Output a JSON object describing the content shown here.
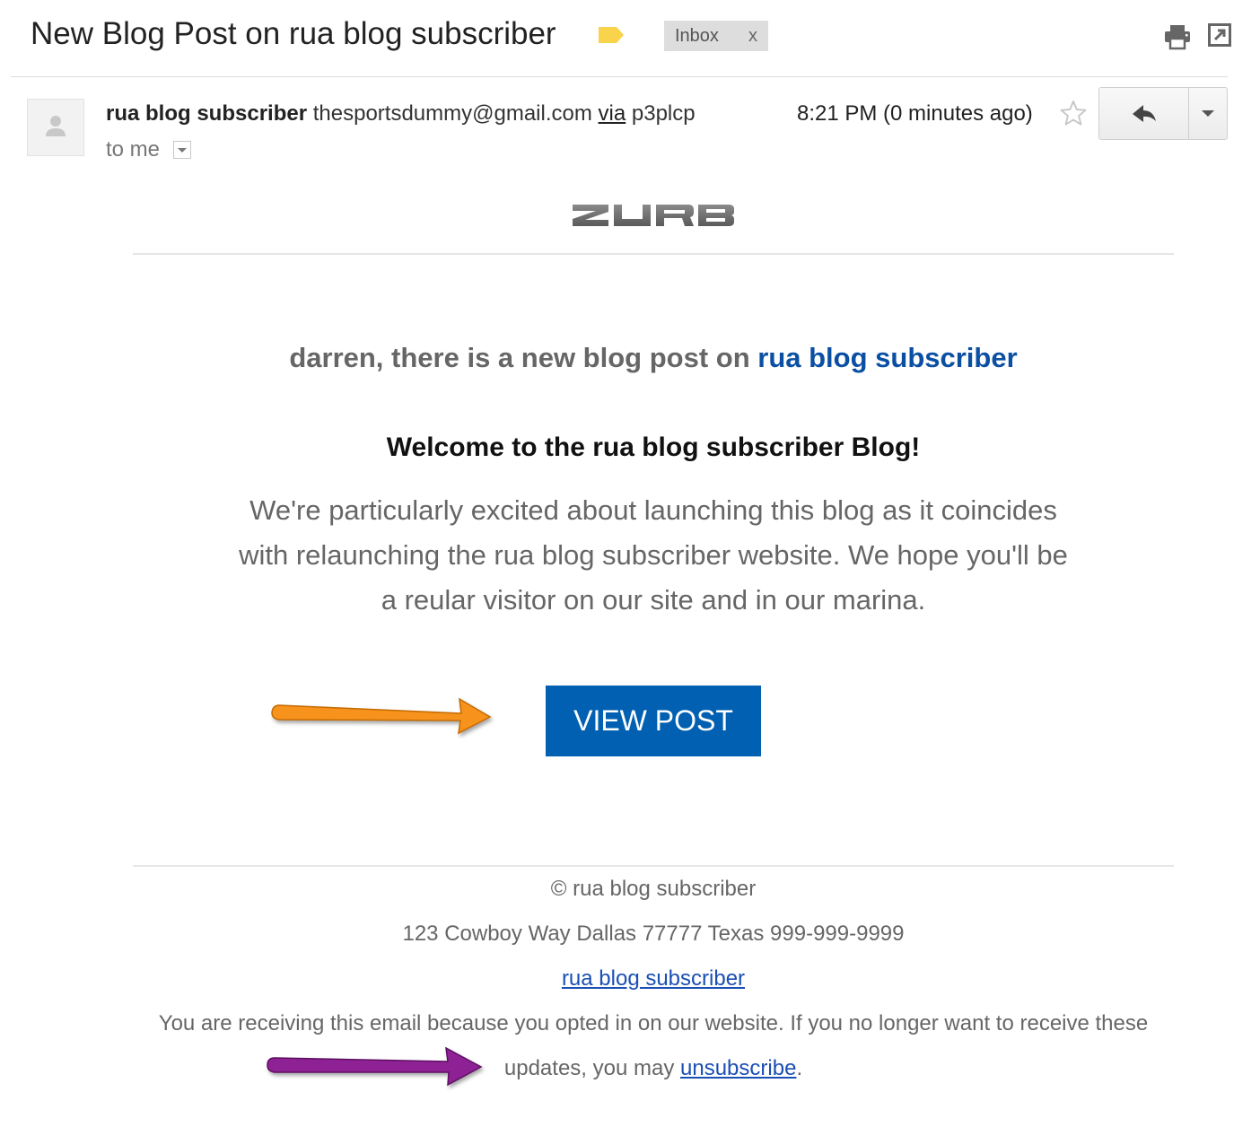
{
  "header": {
    "subject": "New Blog Post on rua blog subscriber",
    "label_chip": "Inbox",
    "label_remove": "x"
  },
  "sender": {
    "name": "rua blog subscriber",
    "email": "thesportsdummy@gmail.com",
    "via_label": "via",
    "via_domain": "p3plcp",
    "recipient": "to me",
    "timestamp": "8:21 PM (0 minutes ago)"
  },
  "icons": {
    "label": "label-tag-icon",
    "print": "print-icon",
    "popout": "open-in-new-window-icon",
    "avatar": "person-icon",
    "star": "star-icon",
    "reply": "reply-icon",
    "more": "chevron-down-icon"
  },
  "email": {
    "greeting_prefix": "darren, there is a new blog post on",
    "greeting_blog": "rua blog subscriber",
    "welcome_title": "Welcome to the rua blog subscriber Blog!",
    "paragraph_line1": "We're particularly excited about launching this blog as it coincides",
    "paragraph_line2": "with relaunching the rua blog subscriber website. We hope you'll be",
    "paragraph_line3": "a reular visitor on our site and in our marina.",
    "button_label": "VIEW POST"
  },
  "footer": {
    "copyright": "© rua blog subscriber",
    "address": "123 Cowboy Way Dallas 77777 Texas 999-999-9999",
    "site_link": "rua blog subscriber",
    "notice_line1": "You are receiving this email because you opted in on our website. If you no longer want to receive these",
    "notice_line2_prefix": "updates, you may",
    "unsubscribe_link": "unsubscribe",
    "notice_end": "."
  },
  "logo_text": "ZURB",
  "colors": {
    "button": "#0160b1",
    "link": "#1a4fb4",
    "annotation_orange": "#f7931e",
    "annotation_purple": "#8e2495",
    "label_tag": "#f8d34b"
  }
}
